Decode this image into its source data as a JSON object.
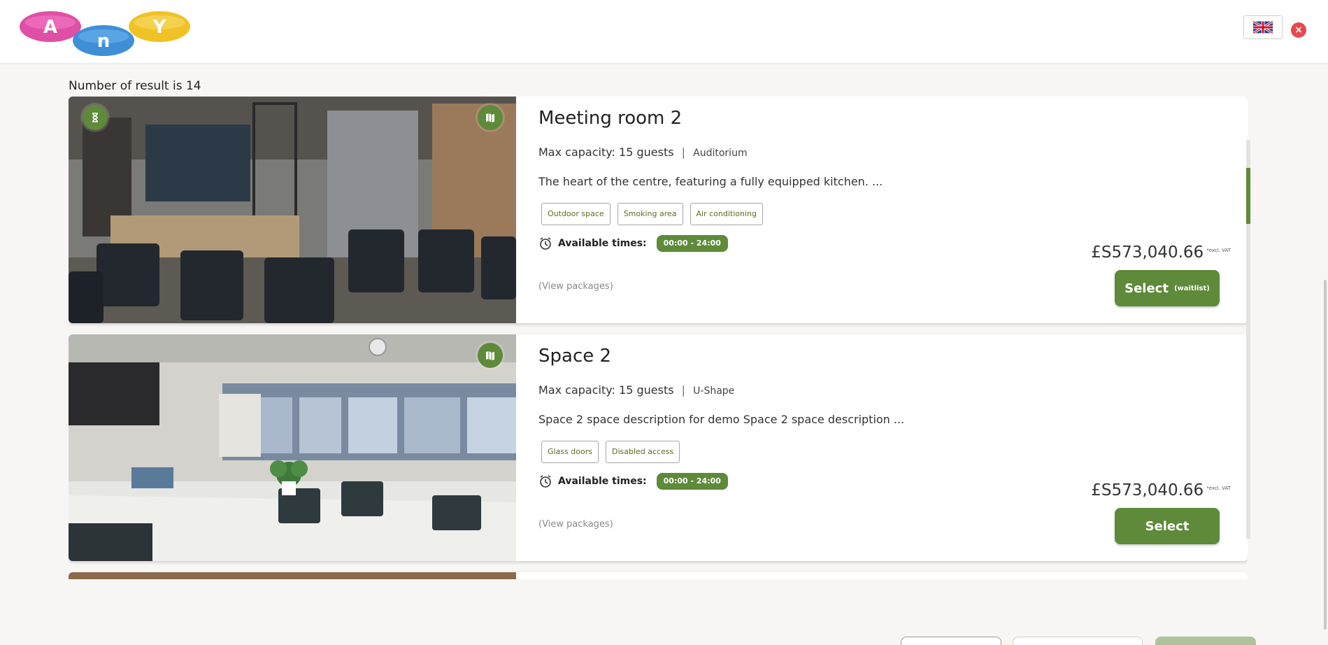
{
  "header": {
    "logo_text": "Any",
    "language_icon": "uk-flag-icon",
    "close_icon": "close-icon"
  },
  "results": {
    "count_text": "Number of result is 14"
  },
  "rooms": [
    {
      "title": "Meeting room 2",
      "capacity_label": "Max capacity:",
      "capacity_value": "15 guests",
      "layout": "Auditorium",
      "description": "The heart of the centre, featuring a fully equipped kitchen. ...",
      "tags": [
        "Outdoor space",
        "Smoking area",
        "Air conditioning"
      ],
      "available_label": "Available times:",
      "time_range": "00:00 - 24:00",
      "view_packages": "(View packages)",
      "price": "£S573,040.66",
      "vat_note": "*excl. VAT",
      "select_label": "Select",
      "select_sub": "(waitlist)"
    },
    {
      "title": "Space 2",
      "capacity_label": "Max capacity:",
      "capacity_value": "15 guests",
      "layout": "U-Shape",
      "description": "Space 2 space description for demo Space 2 space description ...",
      "tags": [
        "Glass doors",
        "Disabled access"
      ],
      "available_label": "Available times:",
      "time_range": "00:00 - 24:00",
      "view_packages": "(View packages)",
      "price": "£S573,040.66",
      "vat_note": "*excl. VAT",
      "select_label": "Select",
      "select_sub": ""
    }
  ],
  "colors": {
    "accent": "#5e8a3a",
    "background": "#f7f6f5",
    "tag_text": "#5e6b20"
  }
}
